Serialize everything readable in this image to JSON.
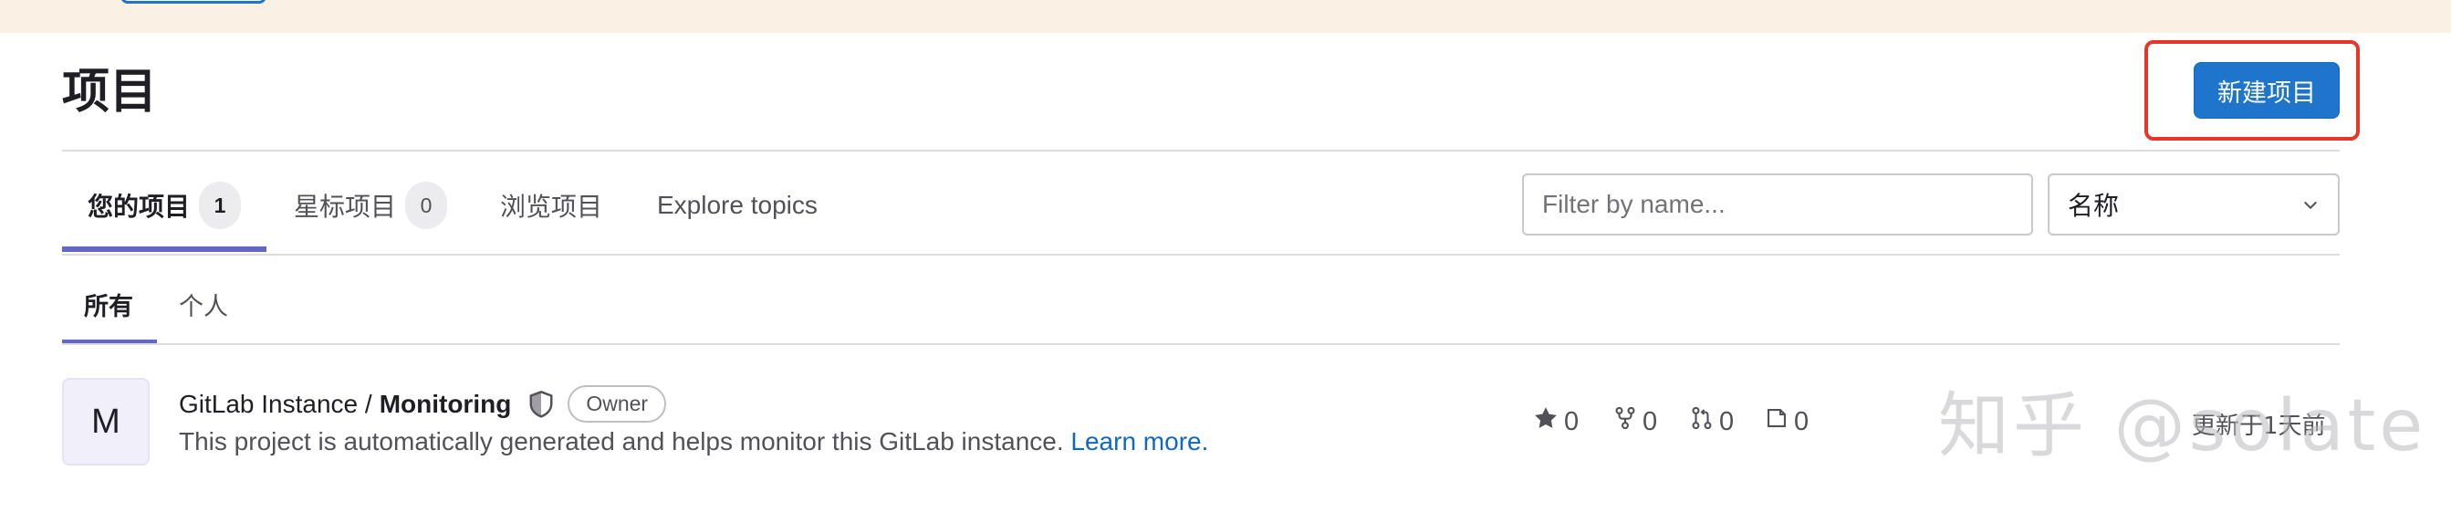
{
  "header": {
    "title": "项目",
    "new_project_label": "新建项目"
  },
  "tabs": [
    {
      "label": "您的项目",
      "count": "1",
      "active": true
    },
    {
      "label": "星标项目",
      "count": "0",
      "active": false
    },
    {
      "label": "浏览项目",
      "active": false
    },
    {
      "label": "Explore topics",
      "active": false
    }
  ],
  "filter": {
    "placeholder": "Filter by name...",
    "value": ""
  },
  "sort": {
    "selected": "名称"
  },
  "subtabs": [
    {
      "label": "所有",
      "active": true
    },
    {
      "label": "个人",
      "active": false
    }
  ],
  "project": {
    "avatar_letter": "M",
    "namespace": "GitLab Instance /",
    "name": "Monitoring",
    "role_badge": "Owner",
    "description": "This project is automatically generated and helps monitor this GitLab instance.",
    "learn_more": "Learn more.",
    "stats": {
      "stars": "0",
      "forks": "0",
      "merge_requests": "0",
      "issues": "0"
    },
    "updated": "更新于1天前"
  },
  "watermark": "知乎 @solate",
  "colors": {
    "primary_button": "#1f75cb",
    "tab_indicator": "#6666c4",
    "highlight_border": "#e8352a",
    "banner_bg": "#fbf0e4",
    "link": "#1068bf"
  },
  "icons": {
    "shield": "shield-icon",
    "star": "star-icon",
    "fork": "fork-icon",
    "merge_request": "merge-request-icon",
    "issue": "issue-icon",
    "chevron": "chevron-down-icon"
  }
}
